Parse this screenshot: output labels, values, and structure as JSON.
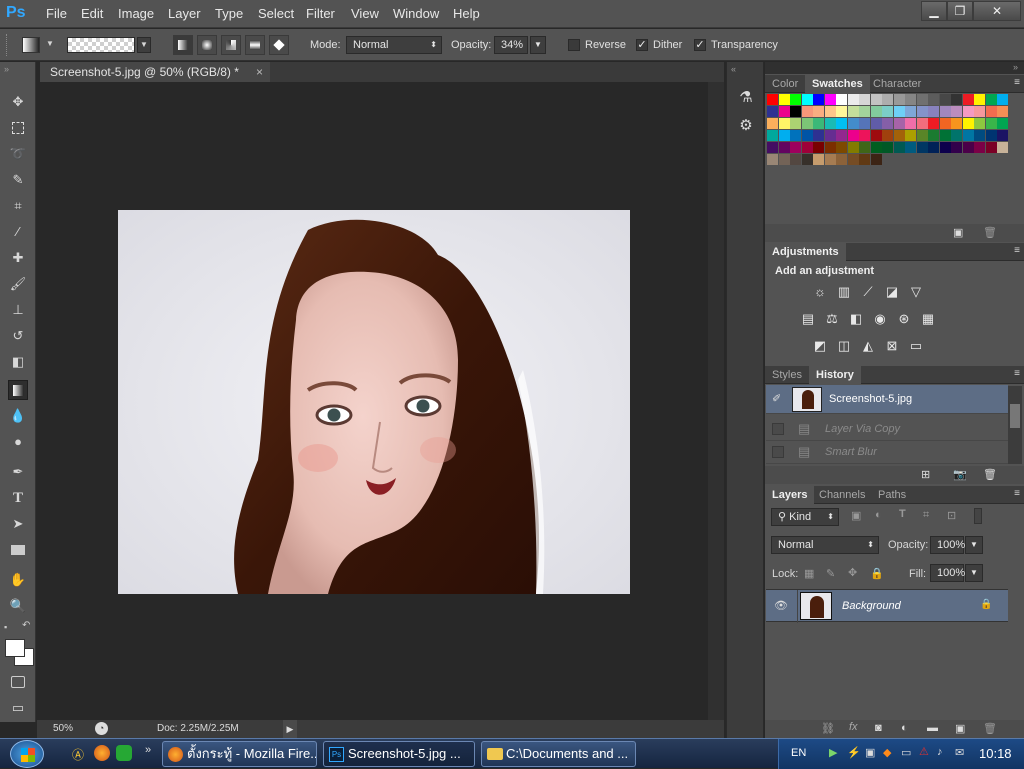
{
  "app": {
    "logo": "Ps"
  },
  "menu": [
    "File",
    "Edit",
    "Image",
    "Layer",
    "Type",
    "Select",
    "Filter",
    "View",
    "Window",
    "Help"
  ],
  "window_controls": {
    "minimize": "▁",
    "restore": "❐",
    "close": "✕"
  },
  "options": {
    "mode_label": "Mode:",
    "mode_value": "Normal",
    "opacity_label": "Opacity:",
    "opacity_value": "34%",
    "reverse_label": "Reverse",
    "reverse_checked": false,
    "dither_label": "Dither",
    "dither_checked": true,
    "transparency_label": "Transparency",
    "transparency_checked": true
  },
  "document": {
    "tab_title": "Screenshot-5.jpg @ 50% (RGB/8) *",
    "zoom": "50%",
    "doc_size": "Doc: 2.25M/2.25M"
  },
  "panels": {
    "top_tabs": [
      "Color",
      "Swatches",
      "Character"
    ],
    "top_active": "Swatches",
    "adjustments_title": "Adjustments",
    "adjustments_subtitle": "Add an adjustment",
    "history_tabs": [
      "Styles",
      "History"
    ],
    "history_active": "History",
    "history_items": [
      {
        "label": "Screenshot-5.jpg",
        "selected": true
      },
      {
        "label": "Layer Via Copy",
        "selected": false
      },
      {
        "label": "Smart Blur",
        "selected": false
      }
    ],
    "layers_tabs": [
      "Layers",
      "Channels",
      "Paths"
    ],
    "layers_active": "Layers",
    "kind_label": "Kind",
    "blend_mode": "Normal",
    "layer_opacity_label": "Opacity:",
    "layer_opacity": "100%",
    "lock_label": "Lock:",
    "fill_label": "Fill:",
    "fill_value": "100%",
    "layers": [
      {
        "name": "Background",
        "visible": true,
        "locked": true
      }
    ]
  },
  "swatch_colors": [
    "#ff0000",
    "#ffff00",
    "#00ff00",
    "#00ffff",
    "#0000ff",
    "#ff00ff",
    "#ffffff",
    "#ebebeb",
    "#d6d6d6",
    "#c2c2c2",
    "#adadad",
    "#999999",
    "#858585",
    "#707070",
    "#5c5c5c",
    "#474747",
    "#333333",
    "#ed1c24",
    "#fff200",
    "#00a651",
    "#00aeef",
    "#2e3192",
    "#ec008c",
    "#000000",
    "#f7977a",
    "#f9ad81",
    "#fdc68a",
    "#fff79a",
    "#c4df9b",
    "#a3d39c",
    "#82ca9d",
    "#7bcdc8",
    "#6ecff6",
    "#7ea7d8",
    "#8493ca",
    "#8882be",
    "#a187be",
    "#bc8dbf",
    "#f49ac2",
    "#f6989d",
    "#f26c4f",
    "#f68e55",
    "#fbaf5c",
    "#fff467",
    "#acd372",
    "#7cc576",
    "#3bb878",
    "#1abbb4",
    "#00bff3",
    "#438ccb",
    "#5574b9",
    "#605ca8",
    "#855fa8",
    "#a763a8",
    "#f06ea9",
    "#f26d7d",
    "#ed1c24",
    "#f26522",
    "#f7941d",
    "#fff200",
    "#8dc73f",
    "#39b54a",
    "#00a651",
    "#00a99d",
    "#00aeef",
    "#0072bc",
    "#0054a6",
    "#2e3192",
    "#662d91",
    "#92278f",
    "#ec008c",
    "#ed145b",
    "#9e0b0f",
    "#a0410d",
    "#a36209",
    "#aba000",
    "#598527",
    "#1a7b30",
    "#007236",
    "#00746b",
    "#0076a3",
    "#004b80",
    "#003471",
    "#1b1464",
    "#440e62",
    "#630460",
    "#9e005d",
    "#9e0039",
    "#790000",
    "#7b2e00",
    "#7d4900",
    "#827b00",
    "#406618",
    "#005e20",
    "#005826",
    "#005952",
    "#005b7f",
    "#003663",
    "#002157",
    "#0d004c",
    "#32004b",
    "#4b0049",
    "#7b0046",
    "#7a0026",
    "#c7b299",
    "#998675",
    "#736357",
    "#534741",
    "#37302a",
    "#c69c6d",
    "#a67c52",
    "#8c6239",
    "#754c24",
    "#603913",
    "#3c2415"
  ],
  "adjustment_icons": [
    [
      "brightness-contrast",
      "levels",
      "curves",
      "exposure",
      "vibrance"
    ],
    [
      "hue-saturation",
      "color-balance",
      "black-white",
      "photo-filter",
      "channel-mixer",
      "color-lookup"
    ],
    [
      "invert",
      "posterize",
      "threshold",
      "selective-color",
      "gradient-map"
    ]
  ],
  "taskbar": {
    "items": [
      {
        "label": "ตั้งกระทู้ - Mozilla Fire...",
        "icon": "firefox-icon"
      },
      {
        "label": "Screenshot-5.jpg ...",
        "icon": "photoshop-icon"
      },
      {
        "label": "C:\\Documents and ...",
        "icon": "folder-icon"
      }
    ],
    "language": "EN",
    "time": "10:18"
  }
}
